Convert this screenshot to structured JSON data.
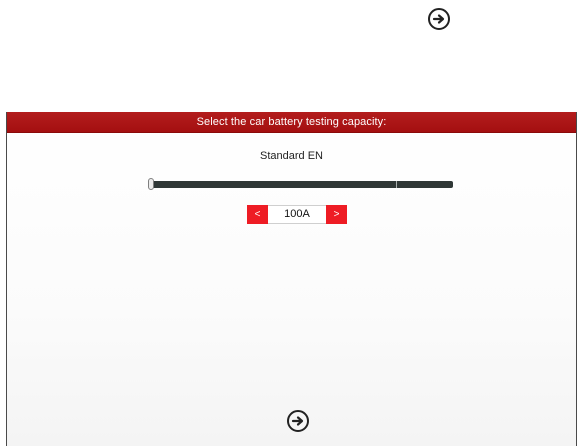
{
  "header": {
    "title": "Select the car battery testing capacity:"
  },
  "standard": {
    "label": "Standard EN"
  },
  "capacity": {
    "value": "100A",
    "decrement_label": "<",
    "increment_label": ">",
    "slider_fraction": 0.0
  },
  "icons": {
    "top_next": "arrow-right-circle-icon",
    "bottom_next": "arrow-right-circle-icon"
  },
  "colors": {
    "header_bg": "#a81414",
    "stepper_button": "#ee1c24",
    "slider_track": "#2f3736"
  }
}
